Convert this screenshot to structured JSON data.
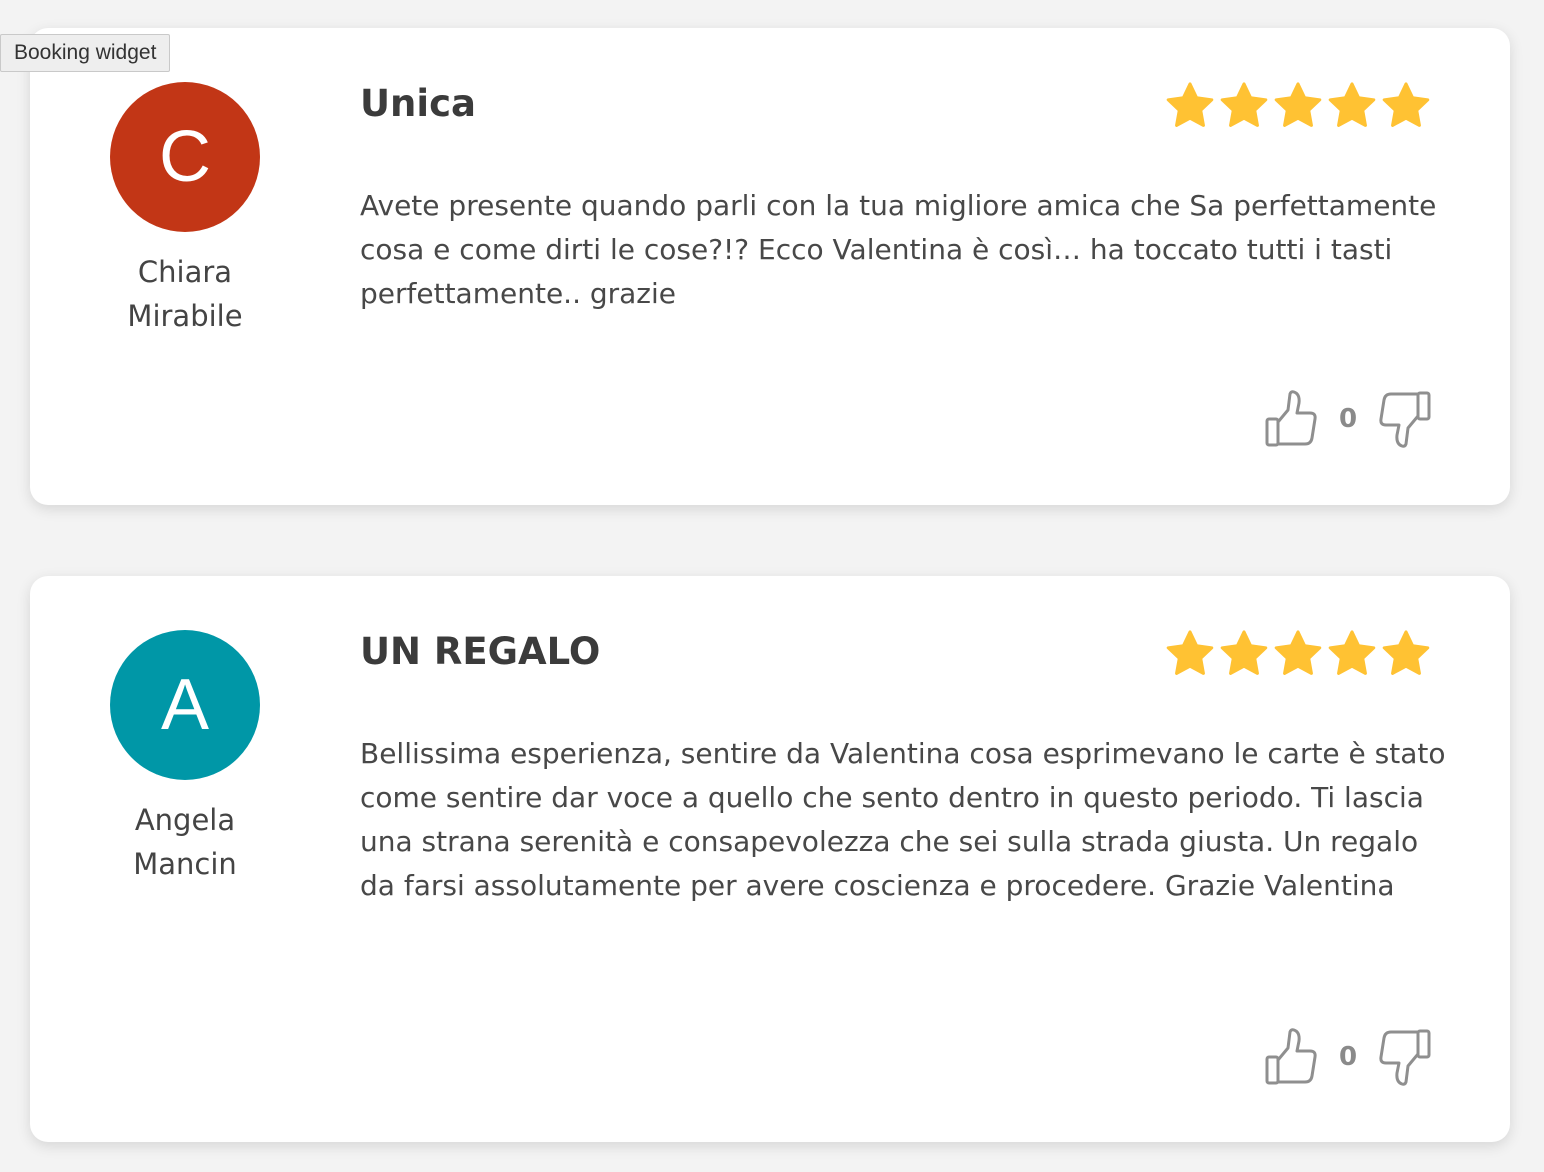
{
  "tooltip": {
    "text": "Booking widget"
  },
  "colors": {
    "star": "#FFC233",
    "avatar_1": "#C23616",
    "avatar_2": "#0097A7"
  },
  "reviews": [
    {
      "initial": "C",
      "author_first": "Chiara",
      "author_last": "Mirabile",
      "title": "Unica",
      "rating": 5,
      "text": "Avete presente quando parli con la tua migliore amica che Sa perfettamente cosa e come dirti le cose?!? Ecco Valentina è così… ha toccato tutti i tasti perfettamente.. grazie",
      "votes": "0",
      "icons": [
        "thumbs-up-icon",
        "thumbs-down-icon",
        "star-icon"
      ]
    },
    {
      "initial": "A",
      "author_first": "Angela",
      "author_last": "Mancin",
      "title": "UN REGALO",
      "rating": 5,
      "text": "Bellissima esperienza, sentire da Valentina cosa esprimevano le carte è stato come sentire dar voce a quello che sento dentro in questo periodo. Ti lascia una strana serenità e consapevolezza che sei sulla strada giusta. Un regalo da farsi assolutamente per avere coscienza e procedere. Grazie Valentina",
      "votes": "0",
      "icons": [
        "thumbs-up-icon",
        "thumbs-down-icon",
        "star-icon"
      ]
    }
  ]
}
